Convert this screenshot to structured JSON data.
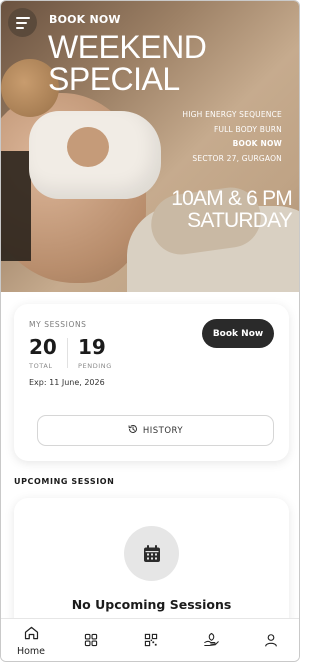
{
  "hero": {
    "eyebrow": "BOOK NOW",
    "title_line1": "WEEKEND",
    "title_line2": "SPECIAL",
    "details": [
      "HIGH ENERGY SEQUENCE",
      "FULL BODY BURN",
      "BOOK NOW",
      "SECTOR 27, GURGAON"
    ],
    "time_line1": "10AM & 6 PM",
    "time_line2": "SATURDAY"
  },
  "sessions": {
    "label": "MY SESSIONS",
    "total_value": "20",
    "total_label": "TOTAL",
    "pending_value": "19",
    "pending_label": "PENDING",
    "expiry": "Exp: 11 June, 2026",
    "book_button": "Book Now",
    "history_button": "HISTORY"
  },
  "upcoming": {
    "heading": "UPCOMING SESSION",
    "empty_text": "No Upcoming Sessions"
  },
  "nav": {
    "items": [
      {
        "label": "Home",
        "icon": "home-icon"
      },
      {
        "label": "",
        "icon": "grid-icon"
      },
      {
        "label": "",
        "icon": "qr-code-icon"
      },
      {
        "label": "",
        "icon": "leaf-hand-icon"
      },
      {
        "label": "",
        "icon": "profile-icon"
      }
    ]
  },
  "colors": {
    "primary_dark": "#2a2a2a",
    "hero_brown": "#9c8065",
    "card_shadow": "#e6e6e6"
  }
}
